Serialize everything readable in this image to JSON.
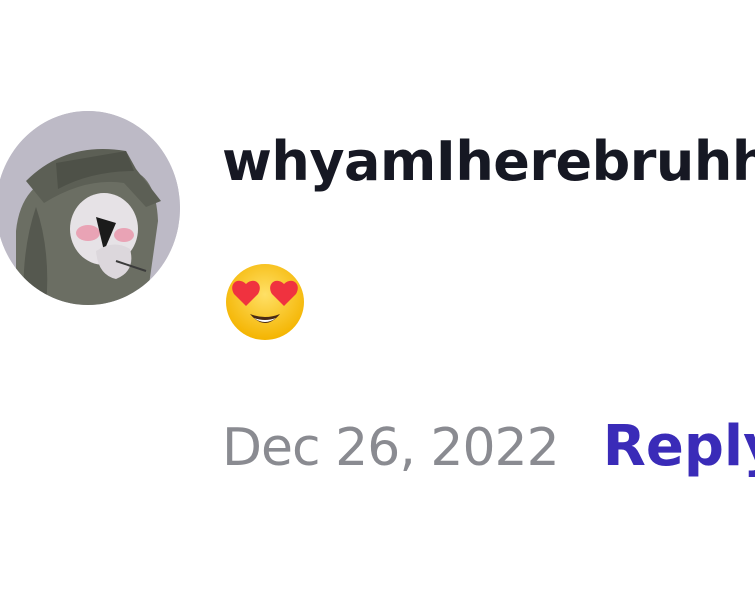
{
  "comment": {
    "avatar": {
      "icon": "user-avatar-image"
    },
    "username": "whyamIherebruhh",
    "body_emoji": "smiling-face-with-heart-eyes",
    "date": "Dec 26, 2022",
    "reply_label": "Reply"
  },
  "colors": {
    "username": "#161823",
    "date": "#8a8b91",
    "reply": "#3a2bb8",
    "avatar_bg": "#bfbcc8"
  }
}
